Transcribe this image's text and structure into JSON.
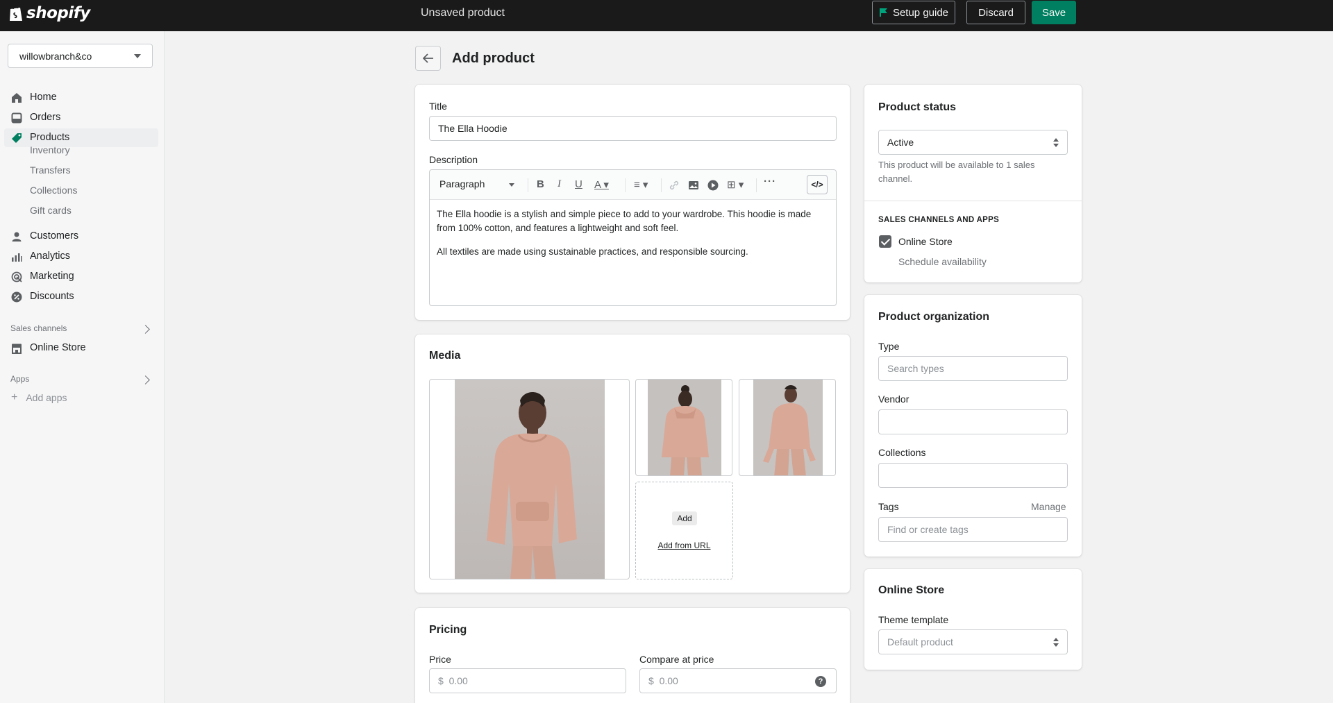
{
  "topbar": {
    "logo_text": "shopify",
    "status": "Unsaved product",
    "setup_guide": "Setup guide",
    "discard": "Discard",
    "save": "Save",
    "save_color": "#008060"
  },
  "sidebar": {
    "store": "willowbranch&co",
    "items": [
      {
        "label": "Home",
        "icon": "home-icon"
      },
      {
        "label": "Orders",
        "icon": "orders-icon"
      },
      {
        "label": "Products",
        "icon": "tag-icon"
      },
      {
        "label": "Customers",
        "icon": "person-icon"
      },
      {
        "label": "Analytics",
        "icon": "bar-chart-icon"
      },
      {
        "label": "Marketing",
        "icon": "target-icon"
      },
      {
        "label": "Discounts",
        "icon": "discount-icon"
      }
    ],
    "product_subitems": [
      "Inventory",
      "Transfers",
      "Collections",
      "Gift cards"
    ],
    "sales_channels_label": "Sales channels",
    "online_store": "Online Store",
    "apps_label": "Apps",
    "add_apps": "Add apps"
  },
  "page": {
    "title": "Add product"
  },
  "product": {
    "title_label": "Title",
    "title_value": "The Ella Hoodie",
    "description_label": "Description",
    "toolbar_paragraph": "Paragraph",
    "description_p1": "The Ella hoodie is a stylish and simple piece to add to your wardrobe. This hoodie is made from 100% cotton, and features a lightweight and soft feel.",
    "description_p2": "All textiles are made using sustainable practices, and responsible sourcing."
  },
  "media": {
    "title": "Media",
    "add": "Add",
    "add_from_url": "Add from URL"
  },
  "pricing": {
    "title": "Pricing",
    "price_label": "Price",
    "price_value": "$  0.00",
    "compare_label": "Compare at price",
    "compare_value": "$  0.00"
  },
  "status": {
    "title": "Product status",
    "value": "Active",
    "help": "This product will be available to 1 sales channel.",
    "channels_heading": "SALES CHANNELS AND APPS",
    "channel": "Online Store",
    "schedule": "Schedule availability"
  },
  "organization": {
    "title": "Product organization",
    "type_label": "Type",
    "type_placeholder": "Search types",
    "vendor_label": "Vendor",
    "collections_label": "Collections",
    "tags_label": "Tags",
    "manage": "Manage",
    "tags_placeholder": "Find or create tags"
  },
  "online_store": {
    "title": "Online Store",
    "template_label": "Theme template",
    "template_value": "Default product"
  }
}
